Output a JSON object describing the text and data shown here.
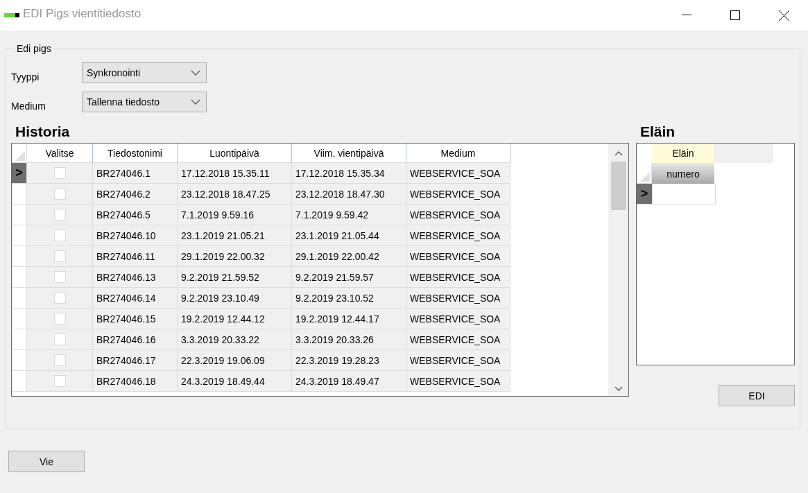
{
  "window": {
    "title": "EDI Pigs vientitiedosto"
  },
  "group": {
    "title": "Edi pigs",
    "fields": [
      {
        "label": "Tyyppi",
        "value": "Synkronointi"
      },
      {
        "label": "Medium",
        "value": "Tallenna tiedosto"
      }
    ]
  },
  "history": {
    "title": "Historia",
    "checkbox_column": "Valitse",
    "columns": [
      "Tiedostonimi",
      "Luontipäivä",
      "Viim. vientipäivä",
      "Medium"
    ],
    "rows": [
      {
        "current": true,
        "marker": ">",
        "checked": false,
        "cells": [
          "BR274046.1",
          "17.12.2018 15.35.11",
          "17.12.2018 15.35.34",
          "WEBSERVICE_SOA"
        ]
      },
      {
        "current": false,
        "checked": false,
        "cells": [
          "BR274046.2",
          "23.12.2018 18.47.25",
          "23.12.2018 18.47.30",
          "WEBSERVICE_SOA"
        ]
      },
      {
        "current": false,
        "checked": false,
        "cells": [
          "BR274046.5",
          "7.1.2019 9.59.16",
          "7.1.2019 9.59.42",
          "WEBSERVICE_SOA"
        ]
      },
      {
        "current": false,
        "checked": false,
        "cells": [
          "BR274046.10",
          "23.1.2019 21.05.21",
          "23.1.2019 21.05.44",
          "WEBSERVICE_SOA"
        ]
      },
      {
        "current": false,
        "checked": false,
        "cells": [
          "BR274046.11",
          "29.1.2019 22.00.32",
          "29.1.2019 22.00.42",
          "WEBSERVICE_SOA"
        ]
      },
      {
        "current": false,
        "checked": false,
        "cells": [
          "BR274046.13",
          "9.2.2019 21.59.52",
          "9.2.2019 21.59.57",
          "WEBSERVICE_SOA"
        ]
      },
      {
        "current": false,
        "checked": false,
        "cells": [
          "BR274046.14",
          "9.2.2019 23.10.49",
          "9.2.2019 23.10.52",
          "WEBSERVICE_SOA"
        ]
      },
      {
        "current": false,
        "checked": false,
        "cells": [
          "BR274046.15",
          "19.2.2019 12.44.12",
          "19.2.2019 12.44.17",
          "WEBSERVICE_SOA"
        ]
      },
      {
        "current": false,
        "checked": false,
        "cells": [
          "BR274046.16",
          "3.3.2019 20.33.22",
          "3.3.2019 20.33.26",
          "WEBSERVICE_SOA"
        ]
      },
      {
        "current": false,
        "checked": false,
        "cells": [
          "BR274046.17",
          "22.3.2019 19.06.09",
          "22.3.2019 19.28.23",
          "WEBSERVICE_SOA"
        ]
      },
      {
        "current": false,
        "checked": false,
        "cells": [
          "BR274046.18",
          "24.3.2019 18.49.44",
          "24.3.2019 18.49.47",
          "WEBSERVICE_SOA"
        ]
      }
    ]
  },
  "animals": {
    "title": "Eläin",
    "group_header": "Eläin",
    "column": "numero",
    "rows": [
      {
        "current": true,
        "marker": ">"
      }
    ]
  },
  "buttons": {
    "edi": "EDI",
    "export": "Vie"
  }
}
